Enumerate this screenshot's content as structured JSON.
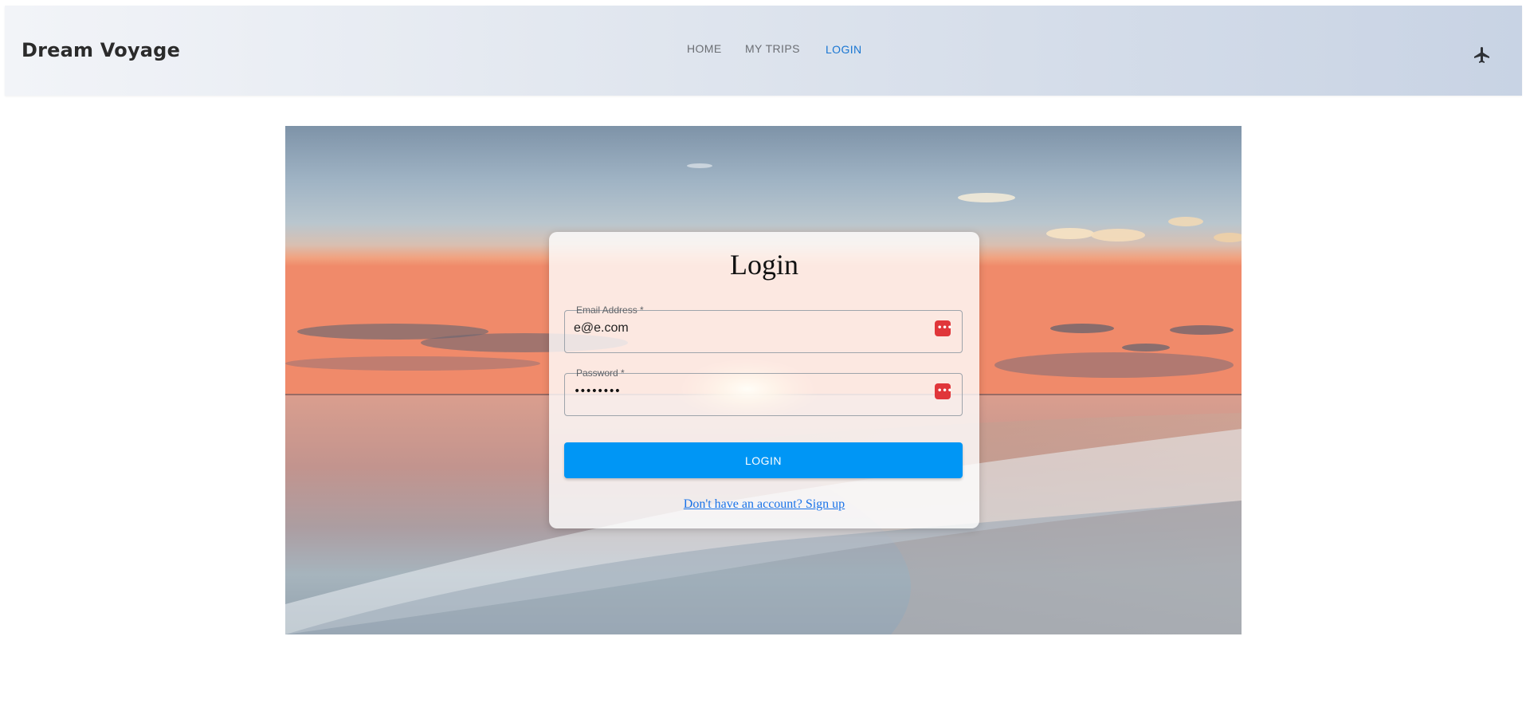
{
  "nav": {
    "brand": "Dream Voyage",
    "links": [
      {
        "label": "HOME",
        "active": false
      },
      {
        "label": "MY TRIPS",
        "active": false
      },
      {
        "label": "LOGIN",
        "active": true
      }
    ],
    "right_icon": "airplane-icon",
    "active_color": "#1976d2"
  },
  "login": {
    "title": "Login",
    "email": {
      "label": "Email Address *",
      "value": "e@e.com",
      "icon": "password-manager-icon"
    },
    "password": {
      "label": "Password *",
      "masked_value": "••••••••",
      "icon": "password-manager-icon"
    },
    "submit_label": "LOGIN",
    "signup_text": "Don't have an account? Sign up",
    "button_color": "#0096f5"
  },
  "hero": {
    "background": "beach sunset photo"
  }
}
